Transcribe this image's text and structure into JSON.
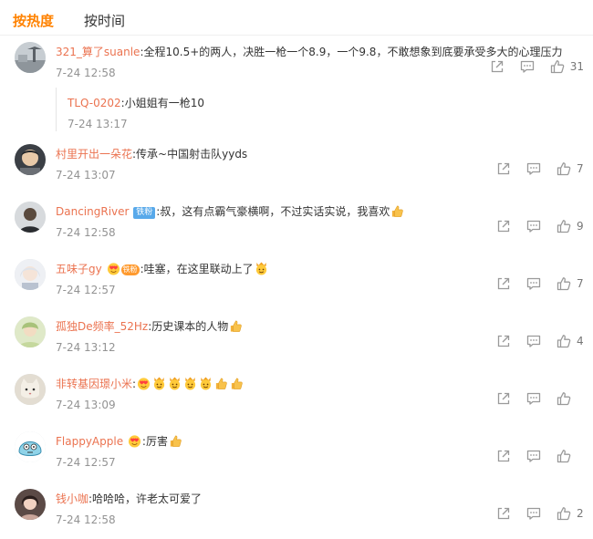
{
  "tabs": {
    "hot": "按热度",
    "time": "按时间"
  },
  "colors": {
    "accent": "#ff8200",
    "username": "#eb7350",
    "timestamp": "#939393",
    "badge_blue": "#58a9ea"
  },
  "comments": [
    {
      "user": "321_算了suanle",
      "text": ":全程10.5+的两人，决胜一枪一个8.9，一个9.8，不敢想象到底要承受多大的心理压力",
      "time": "7-24 12:58",
      "likes": "31",
      "avatar": "landscape-avatar",
      "reply": {
        "user": "TLQ-0202",
        "text": ":小姐姐有一枪10",
        "time": "7-24 13:17"
      }
    },
    {
      "user": "村里开出一朵花",
      "text": ":传承~中国射击队yyds",
      "time": "7-24 13:07",
      "likes": "7",
      "avatar": "anime-avatar"
    },
    {
      "user": "DancingRiver",
      "badge": "铁粉",
      "text": ":叔，这有点霸气豪横啊，不过实话实说，我喜欢",
      "time": "7-24 12:58",
      "likes": "9",
      "avatar": "man-avatar"
    },
    {
      "user": "五味子gy",
      "badge": "铁粉",
      "text": ":哇塞，在这里联动上了",
      "time": "7-24 12:57",
      "likes": "7",
      "avatar": "white-hair-avatar"
    },
    {
      "user": "孤独De频率_52Hz",
      "text": ":历史课本的人物",
      "time": "7-24 13:12",
      "likes": "4",
      "avatar": "green-avatar"
    },
    {
      "user": "非转基因璟小米",
      "text": ":",
      "time": "7-24 13:09",
      "likes": "",
      "avatar": "cat-avatar"
    },
    {
      "user": "FlappyApple",
      "text": ":厉害",
      "time": "7-24 12:57",
      "likes": "",
      "avatar": "cartoon-avatar"
    },
    {
      "user": "钱小咖",
      "text": ":哈哈哈，许老太可爱了",
      "time": "7-24 12:58",
      "likes": "2",
      "avatar": "girl-avatar"
    }
  ]
}
